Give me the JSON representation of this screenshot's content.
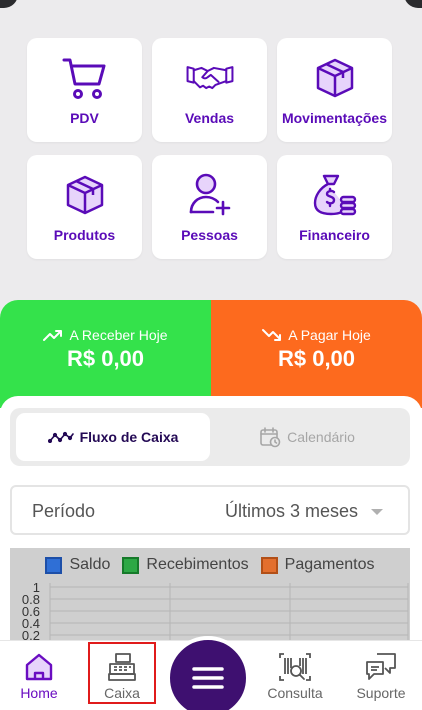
{
  "colors": {
    "brand_purple": "#5a0bb8",
    "receivable_green": "#34e24b",
    "payable_orange": "#fd6a1e",
    "fab_purple": "#3e1070"
  },
  "menu": [
    {
      "label": "PDV",
      "icon": "shopping-cart-icon"
    },
    {
      "label": "Vendas",
      "icon": "handshake-icon"
    },
    {
      "label": "Movimentações",
      "icon": "box-icon"
    },
    {
      "label": "Produtos",
      "icon": "package-icon"
    },
    {
      "label": "Pessoas",
      "icon": "user-add-icon"
    },
    {
      "label": "Financeiro",
      "icon": "money-bag-icon"
    }
  ],
  "summary": {
    "receivable_label": "A Receber Hoje",
    "receivable_value": "R$ 0,00",
    "payable_label": "A Pagar Hoje",
    "payable_value": "R$ 0,00"
  },
  "view_tabs": {
    "cashflow": "Fluxo de Caixa",
    "calendar": "Calendário"
  },
  "period": {
    "label": "Período",
    "value": "Últimos 3 meses"
  },
  "chart_data": {
    "type": "line",
    "series": [
      {
        "name": "Saldo",
        "color": "#2f6fd6",
        "values": []
      },
      {
        "name": "Recebimentos",
        "color": "#2da845",
        "values": []
      },
      {
        "name": "Pagamentos",
        "color": "#e36f2e",
        "values": []
      }
    ],
    "y_ticks": [
      "1",
      "0.8",
      "0.6",
      "0.4",
      "0.2"
    ]
  },
  "bottom_nav": [
    {
      "label": "Home",
      "icon": "home-icon",
      "active": true
    },
    {
      "label": "Caixa",
      "icon": "cash-register-icon",
      "active": false
    },
    {
      "label": "",
      "icon": "menu-icon",
      "active": false
    },
    {
      "label": "Consulta",
      "icon": "barcode-search-icon",
      "active": false
    },
    {
      "label": "Suporte",
      "icon": "chat-icon",
      "active": false
    }
  ]
}
